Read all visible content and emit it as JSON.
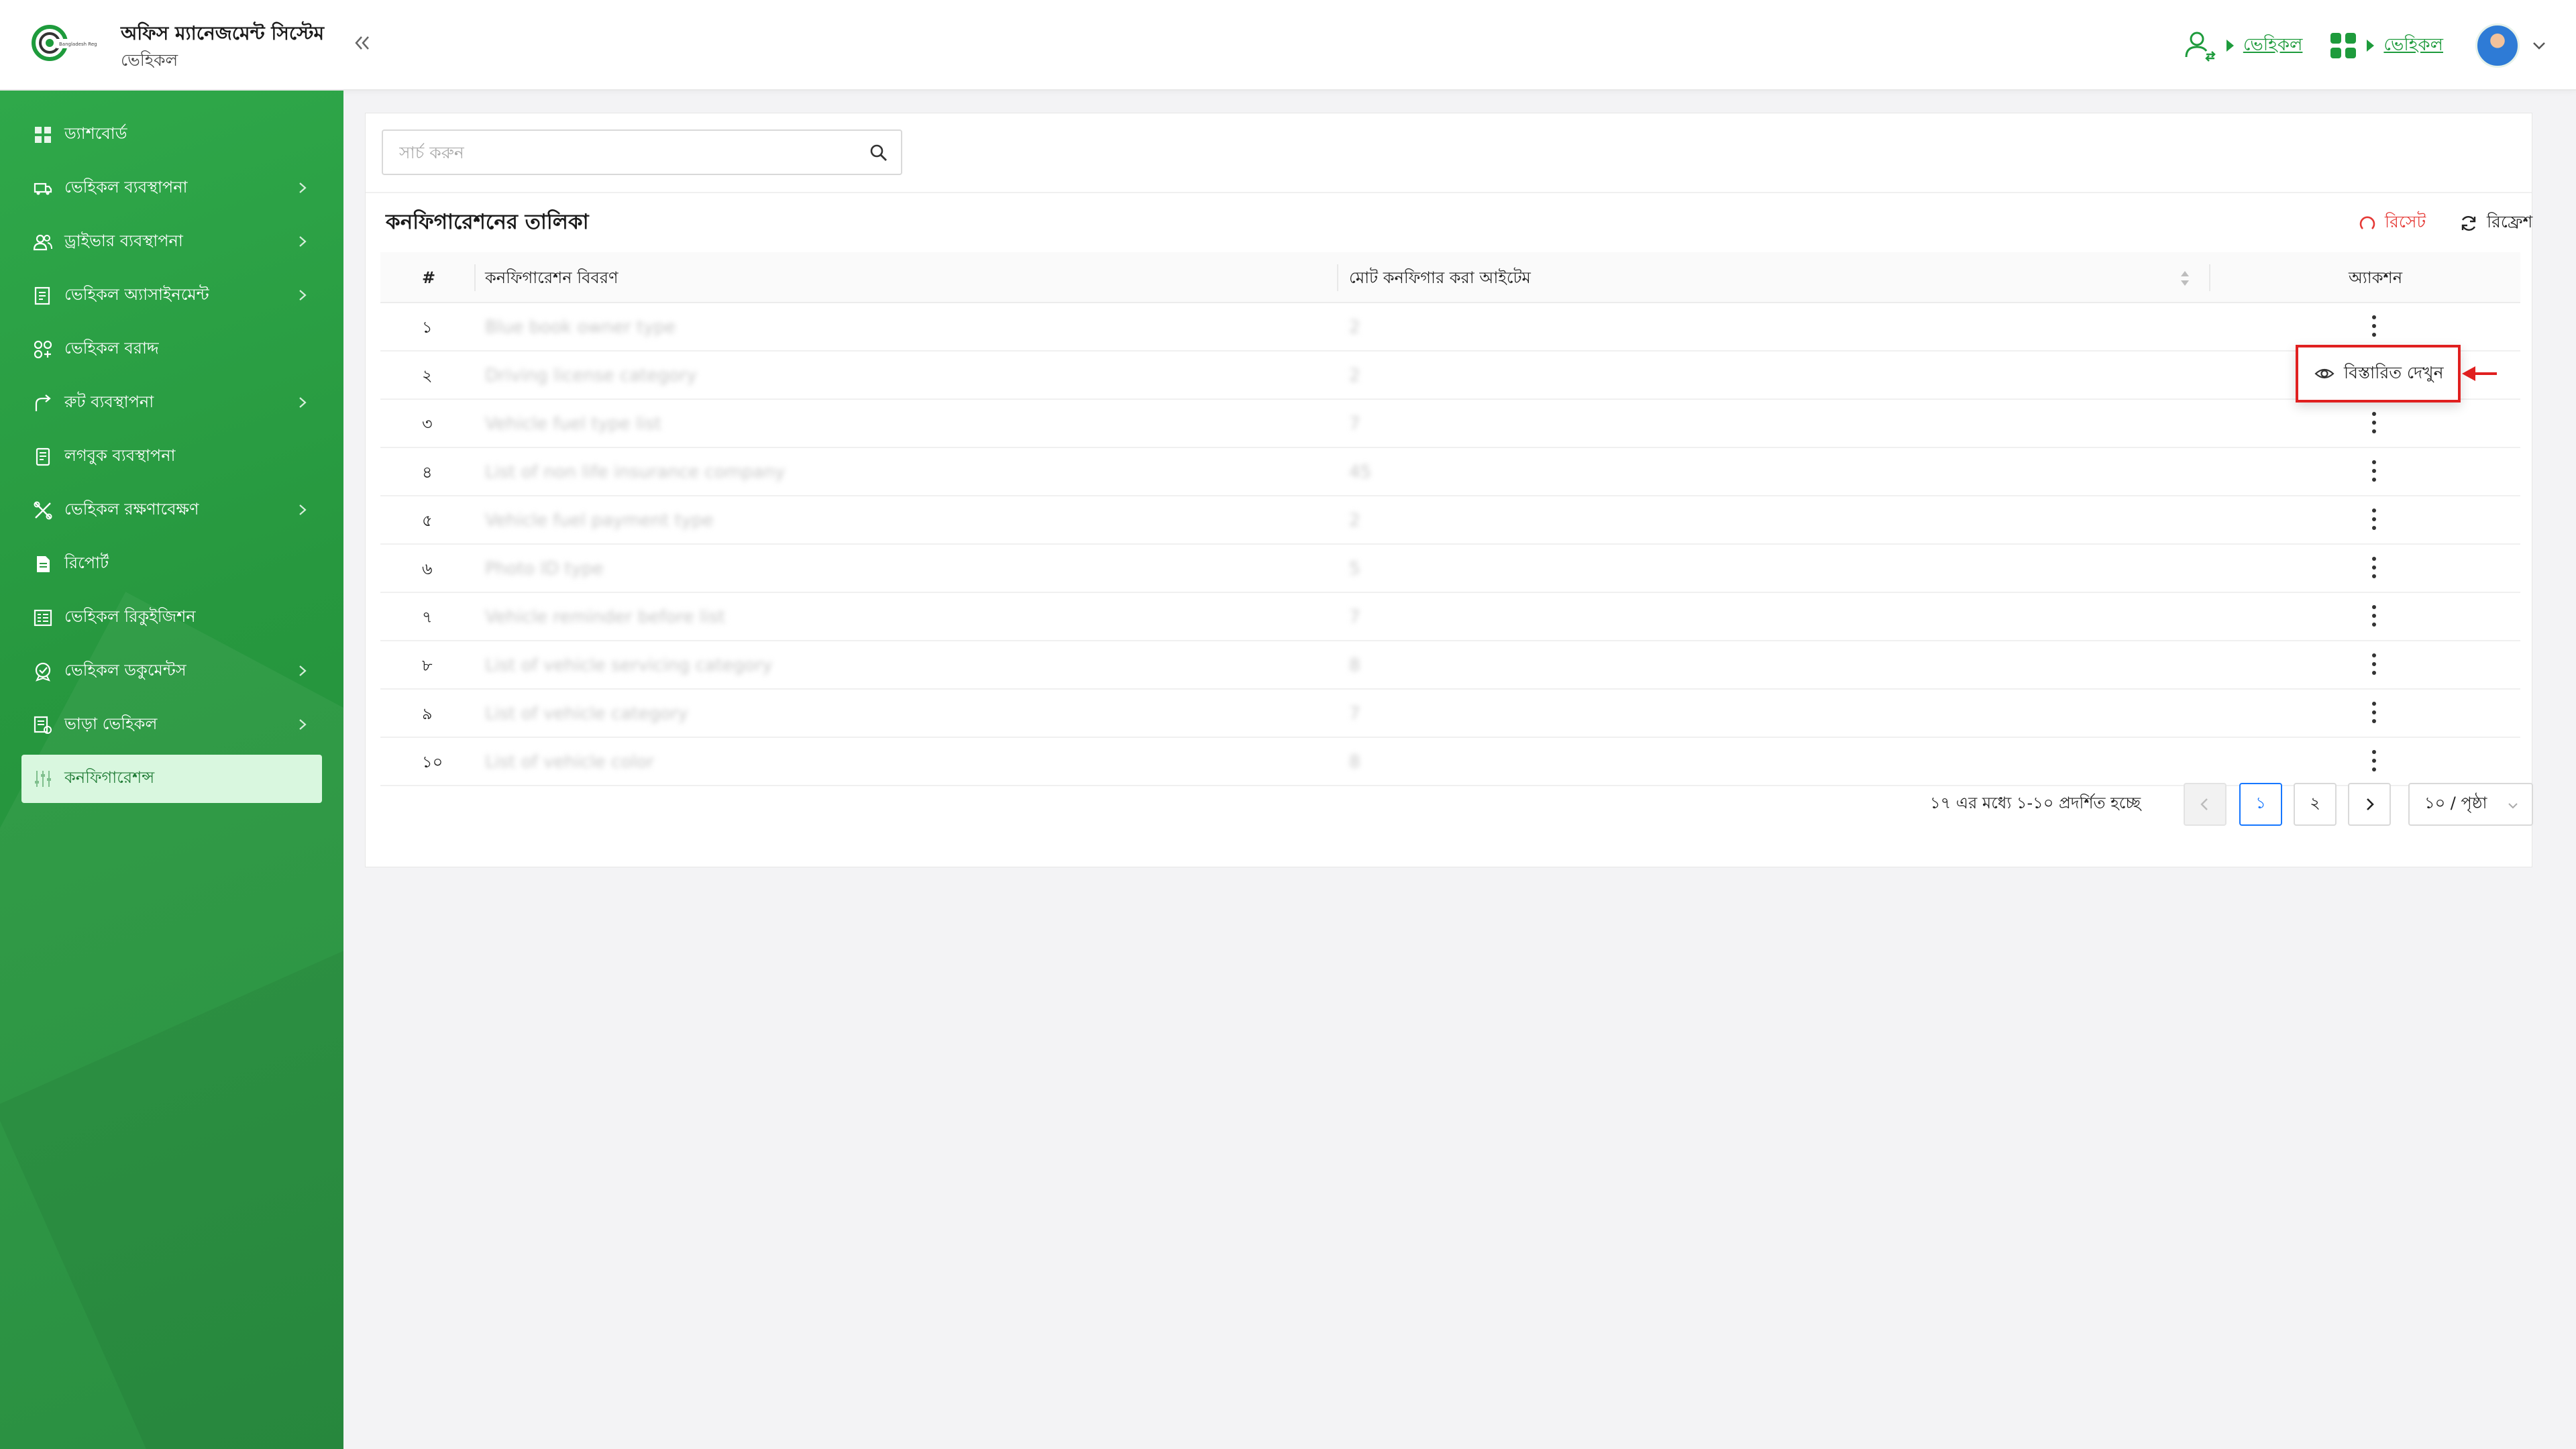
{
  "header": {
    "app_title": "অফিস ম্যানেজমেন্ট সিস্টেম",
    "app_subtitle": "ভেহিকল",
    "logo_text": "Bangladesh Regulatory Authority",
    "breadcrumb_1": "ভেহিকল",
    "breadcrumb_2": "ভেহিকল"
  },
  "sidebar": {
    "items": [
      {
        "label": "ড্যাশবোর্ড",
        "icon": "dashboard-icon",
        "has_children": false
      },
      {
        "label": "ভেহিকল ব্যবস্থাপনা",
        "icon": "vehicle-icon",
        "has_children": true
      },
      {
        "label": "ড্রাইভার ব্যবস্থাপনা",
        "icon": "driver-icon",
        "has_children": true
      },
      {
        "label": "ভেহিকল অ্যাসাইনমেন্ট",
        "icon": "assignment-icon",
        "has_children": true
      },
      {
        "label": "ভেহিকল বরাদ্দ",
        "icon": "allocation-icon",
        "has_children": false
      },
      {
        "label": "রুট ব্যবস্থাপনা",
        "icon": "route-icon",
        "has_children": true
      },
      {
        "label": "লগবুক ব্যবস্থাপনা",
        "icon": "logbook-icon",
        "has_children": false
      },
      {
        "label": "ভেহিকল রক্ষণাবেক্ষণ",
        "icon": "maintenance-icon",
        "has_children": true
      },
      {
        "label": "রিপোর্ট",
        "icon": "report-icon",
        "has_children": false
      },
      {
        "label": "ভেহিকল রিকুইজিশন",
        "icon": "requisition-icon",
        "has_children": false
      },
      {
        "label": "ভেহিকল ডকুমেন্টস",
        "icon": "documents-icon",
        "has_children": true
      },
      {
        "label": "ভাড়া ভেহিকল",
        "icon": "rental-icon",
        "has_children": true
      },
      {
        "label": "কনফিগারেশন্স",
        "icon": "configuration-icon",
        "has_children": false,
        "active": true
      }
    ]
  },
  "search": {
    "placeholder": "সার্চ করুন",
    "value": ""
  },
  "list": {
    "title": "কনফিগারেশনের তালিকা",
    "reset_label": "রিসেট",
    "refresh_label": "রিফ্রেশ",
    "columns": [
      "#",
      "কনফিগারেশন বিবরণ",
      "মোট কনফিগার করা আইটেম",
      "অ্যাকশন"
    ],
    "rows": [
      {
        "num": "১",
        "desc": "Blue book owner type",
        "count": "2"
      },
      {
        "num": "২",
        "desc": "Driving license category",
        "count": "2"
      },
      {
        "num": "৩",
        "desc": "Vehicle fuel type list",
        "count": "7"
      },
      {
        "num": "৪",
        "desc": "List of non life insurance company",
        "count": "45"
      },
      {
        "num": "৫",
        "desc": "Vehicle fuel payment type",
        "count": "2"
      },
      {
        "num": "৬",
        "desc": "Photo ID type",
        "count": "5"
      },
      {
        "num": "৭",
        "desc": "Vehicle reminder before list",
        "count": "7"
      },
      {
        "num": "৮",
        "desc": "List of vehicle servicing category",
        "count": "8"
      },
      {
        "num": "৯",
        "desc": "List of vehicle category",
        "count": "7"
      },
      {
        "num": "১০",
        "desc": "List of vehicle color",
        "count": "8"
      }
    ],
    "action_menu_label": "বিস্তারিত দেখুন"
  },
  "pagination": {
    "info": "১৭ এর মধ্যে ১-১০ প্রদর্শিত হচ্ছে",
    "pages": [
      "১",
      "২"
    ],
    "current_page": "১",
    "page_size": "১০ / পৃষ্ঠা"
  },
  "colors": {
    "brand_green": "#27983f",
    "link_green": "#1e9b3c",
    "active_bg": "#d9f7df",
    "reset_red": "#e53935",
    "highlight_red": "#e02020",
    "pager_blue": "#1677ff"
  }
}
